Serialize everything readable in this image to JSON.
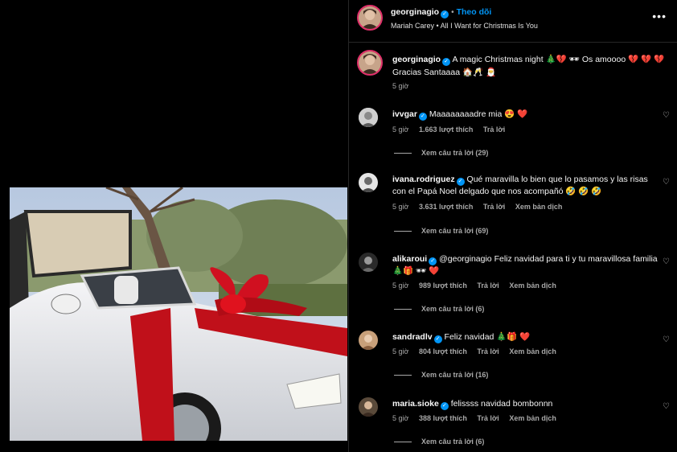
{
  "post": {
    "username": "georginagio",
    "follow_label": "Theo dõi",
    "dot": "•",
    "song": "Mariah Carey • All I Want for Christmas Is You",
    "caption": "A magic Christmas night 🎄💔 🕶 Os amoooo 💔 💔 💔 Gracias Santaaaa 🏠🥂 🎅",
    "time": "5 giờ"
  },
  "comments": [
    {
      "user": "ivvgar",
      "text": "Maaaaaaaadre mia 😍 ❤️",
      "time": "5 giờ",
      "likes": "1.663 lượt thích",
      "reply": "Trả lời",
      "translate": "",
      "replies": "Xem câu trả lời (29)"
    },
    {
      "user": "ivana.rodriguez",
      "text": "Qué maravilla lo bien que lo pasamos y las risas con el Papá Noel delgado que nos acompañó 🤣 🤣 🤣",
      "time": "5 giờ",
      "likes": "3.631 lượt thích",
      "reply": "Trả lời",
      "translate": "Xem bản dịch",
      "replies": "Xem câu trả lời (69)"
    },
    {
      "user": "alikaroui",
      "text": "@georginagio Feliz navidad para ti y tu maravillosa familia 🎄🎁 🕶 ❤️",
      "time": "5 giờ",
      "likes": "989 lượt thích",
      "reply": "Trả lời",
      "translate": "Xem bản dịch",
      "replies": "Xem câu trả lời (6)"
    },
    {
      "user": "sandradlv",
      "text": "Feliz navidad 🎄🎁 ❤️",
      "time": "5 giờ",
      "likes": "804 lượt thích",
      "reply": "Trả lời",
      "translate": "Xem bản dịch",
      "replies": "Xem câu trả lời (16)"
    },
    {
      "user": "maria.sioke",
      "text": "felissss navidad bombonnn",
      "time": "5 giờ",
      "likes": "388 lượt thích",
      "reply": "Trả lời",
      "translate": "Xem bản dịch",
      "replies": "Xem câu trả lời (6)"
    }
  ],
  "icons": {
    "more": "more-options-icon",
    "heart": "heart-icon",
    "verified": "verified-badge-icon"
  },
  "colors": {
    "accent": "#0095f6",
    "ribbon": "#d01020"
  }
}
